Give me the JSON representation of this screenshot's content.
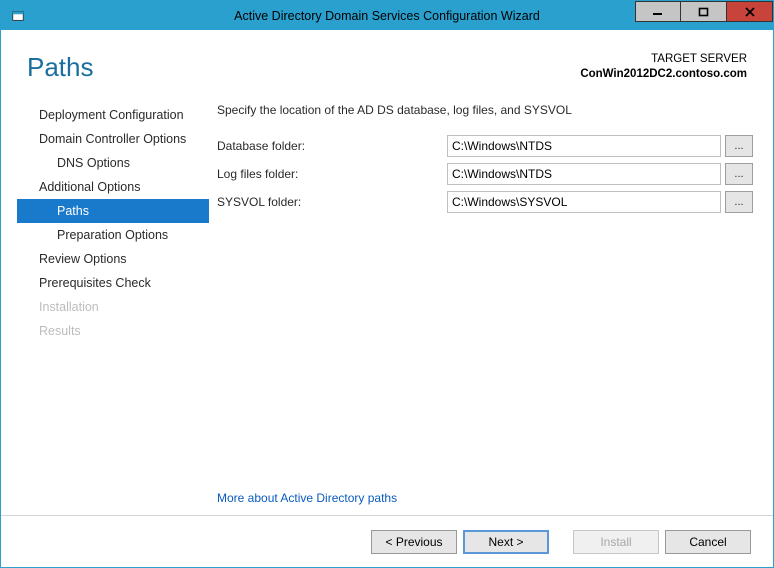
{
  "window": {
    "title": "Active Directory Domain Services Configuration Wizard"
  },
  "header": {
    "page_title": "Paths",
    "target_label": "TARGET SERVER",
    "target_server": "ConWin2012DC2.contoso.com"
  },
  "sidebar": {
    "items": [
      {
        "label": "Deployment Configuration",
        "sub": false,
        "selected": false,
        "disabled": false
      },
      {
        "label": "Domain Controller Options",
        "sub": false,
        "selected": false,
        "disabled": false
      },
      {
        "label": "DNS Options",
        "sub": true,
        "selected": false,
        "disabled": false
      },
      {
        "label": "Additional Options",
        "sub": false,
        "selected": false,
        "disabled": false
      },
      {
        "label": "Paths",
        "sub": true,
        "selected": true,
        "disabled": false
      },
      {
        "label": "Preparation Options",
        "sub": true,
        "selected": false,
        "disabled": false
      },
      {
        "label": "Review Options",
        "sub": false,
        "selected": false,
        "disabled": false
      },
      {
        "label": "Prerequisites Check",
        "sub": false,
        "selected": false,
        "disabled": false
      },
      {
        "label": "Installation",
        "sub": false,
        "selected": false,
        "disabled": true
      },
      {
        "label": "Results",
        "sub": false,
        "selected": false,
        "disabled": true
      }
    ]
  },
  "main": {
    "instructions": "Specify the location of the AD DS database, log files, and SYSVOL",
    "fields": {
      "database": {
        "label": "Database folder:",
        "value": "C:\\Windows\\NTDS"
      },
      "logfiles": {
        "label": "Log files folder:",
        "value": "C:\\Windows\\NTDS"
      },
      "sysvol": {
        "label": "SYSVOL folder:",
        "value": "C:\\Windows\\SYSVOL"
      }
    },
    "browse_label": "...",
    "more_link": "More about Active Directory paths"
  },
  "footer": {
    "previous": "< Previous",
    "next": "Next >",
    "install": "Install",
    "cancel": "Cancel"
  }
}
